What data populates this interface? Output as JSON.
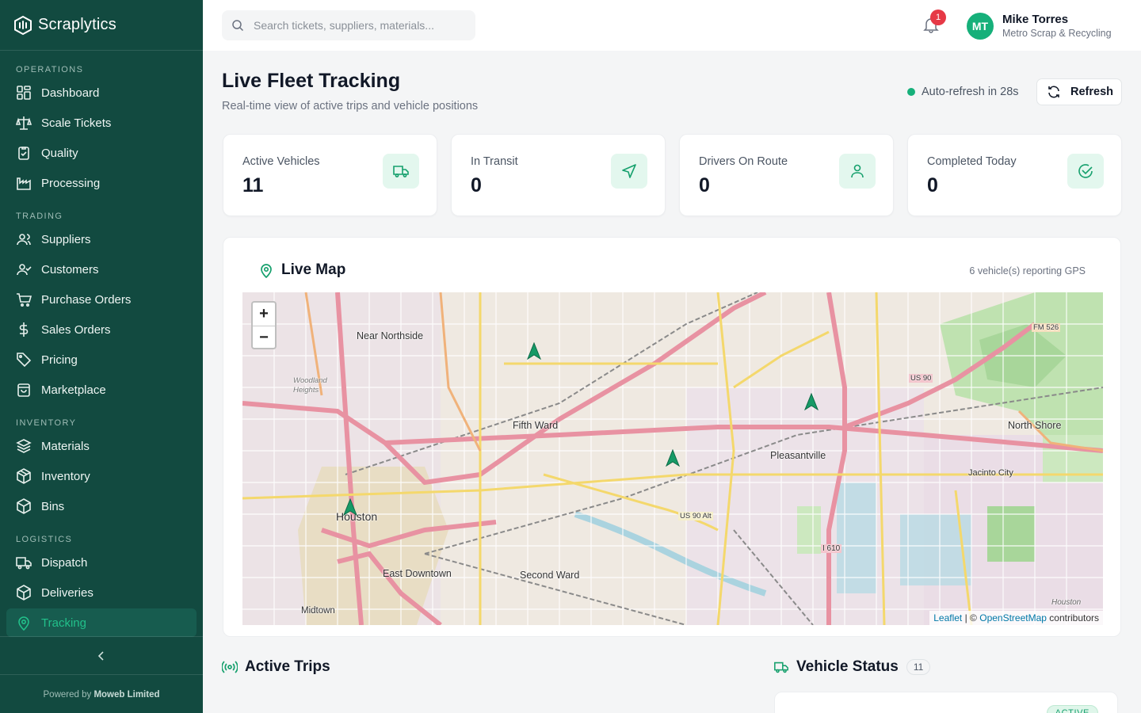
{
  "app": {
    "name": "Scraplytics"
  },
  "sidebar": {
    "sections": [
      {
        "title": "Operations",
        "items": [
          {
            "label": "Dashboard",
            "icon": "dashboard-icon"
          },
          {
            "label": "Scale Tickets",
            "icon": "scale-icon"
          },
          {
            "label": "Quality",
            "icon": "clipboard-check-icon"
          },
          {
            "label": "Processing",
            "icon": "factory-icon"
          }
        ]
      },
      {
        "title": "Trading",
        "items": [
          {
            "label": "Suppliers",
            "icon": "users-icon"
          },
          {
            "label": "Customers",
            "icon": "user-check-icon"
          },
          {
            "label": "Purchase Orders",
            "icon": "cart-icon"
          },
          {
            "label": "Sales Orders",
            "icon": "dollar-icon"
          },
          {
            "label": "Pricing",
            "icon": "tag-icon"
          },
          {
            "label": "Marketplace",
            "icon": "shopping-bag-icon"
          }
        ]
      },
      {
        "title": "Inventory",
        "items": [
          {
            "label": "Materials",
            "icon": "layers-icon"
          },
          {
            "label": "Inventory",
            "icon": "package-icon"
          },
          {
            "label": "Bins",
            "icon": "box-icon"
          }
        ]
      },
      {
        "title": "Logistics",
        "items": [
          {
            "label": "Dispatch",
            "icon": "truck-icon"
          },
          {
            "label": "Deliveries",
            "icon": "package-check-icon"
          },
          {
            "label": "Tracking",
            "icon": "map-pin-icon",
            "active": true
          }
        ]
      }
    ],
    "footer": {
      "prefix": "Powered by",
      "company": "Moweb Limited"
    }
  },
  "header": {
    "search_placeholder": "Search tickets, suppliers, materials...",
    "notification_count": "1",
    "user": {
      "initials": "MT",
      "name": "Mike Torres",
      "org": "Metro Scrap & Recycling"
    }
  },
  "page": {
    "title": "Live Fleet Tracking",
    "subtitle": "Real-time view of active trips and vehicle positions",
    "auto_refresh": "Auto-refresh in 28s",
    "refresh_label": "Refresh"
  },
  "stats": [
    {
      "label": "Active Vehicles",
      "value": "11",
      "icon": "truck-icon"
    },
    {
      "label": "In Transit",
      "value": "0",
      "icon": "navigation-icon"
    },
    {
      "label": "Drivers On Route",
      "value": "0",
      "icon": "user-icon"
    },
    {
      "label": "Completed Today",
      "value": "0",
      "icon": "check-circle-icon"
    }
  ],
  "map": {
    "title": "Live Map",
    "gps_count": "6 vehicle(s) reporting GPS",
    "attribution": {
      "leaflet": "Leaflet",
      "sep": "| ©",
      "osm": "OpenStreetMap",
      "suffix": "contributors"
    },
    "places": [
      "Near Northside",
      "Fifth Ward",
      "Houston",
      "East Downtown",
      "Second Ward",
      "Pleasantville",
      "North Shore",
      "Jacinto City",
      "Midtown",
      "Woodland Heights",
      "US 90 Alt",
      "I 610",
      "US 90",
      "FM 526",
      "Houston"
    ]
  },
  "active_trips": {
    "title": "Active Trips"
  },
  "vehicle_status": {
    "title": "Vehicle Status",
    "count": "11",
    "first_status": "ACTIVE"
  },
  "colors": {
    "sidebar": "#124a40",
    "accent": "#16b07a",
    "active_text": "#22c08a"
  }
}
